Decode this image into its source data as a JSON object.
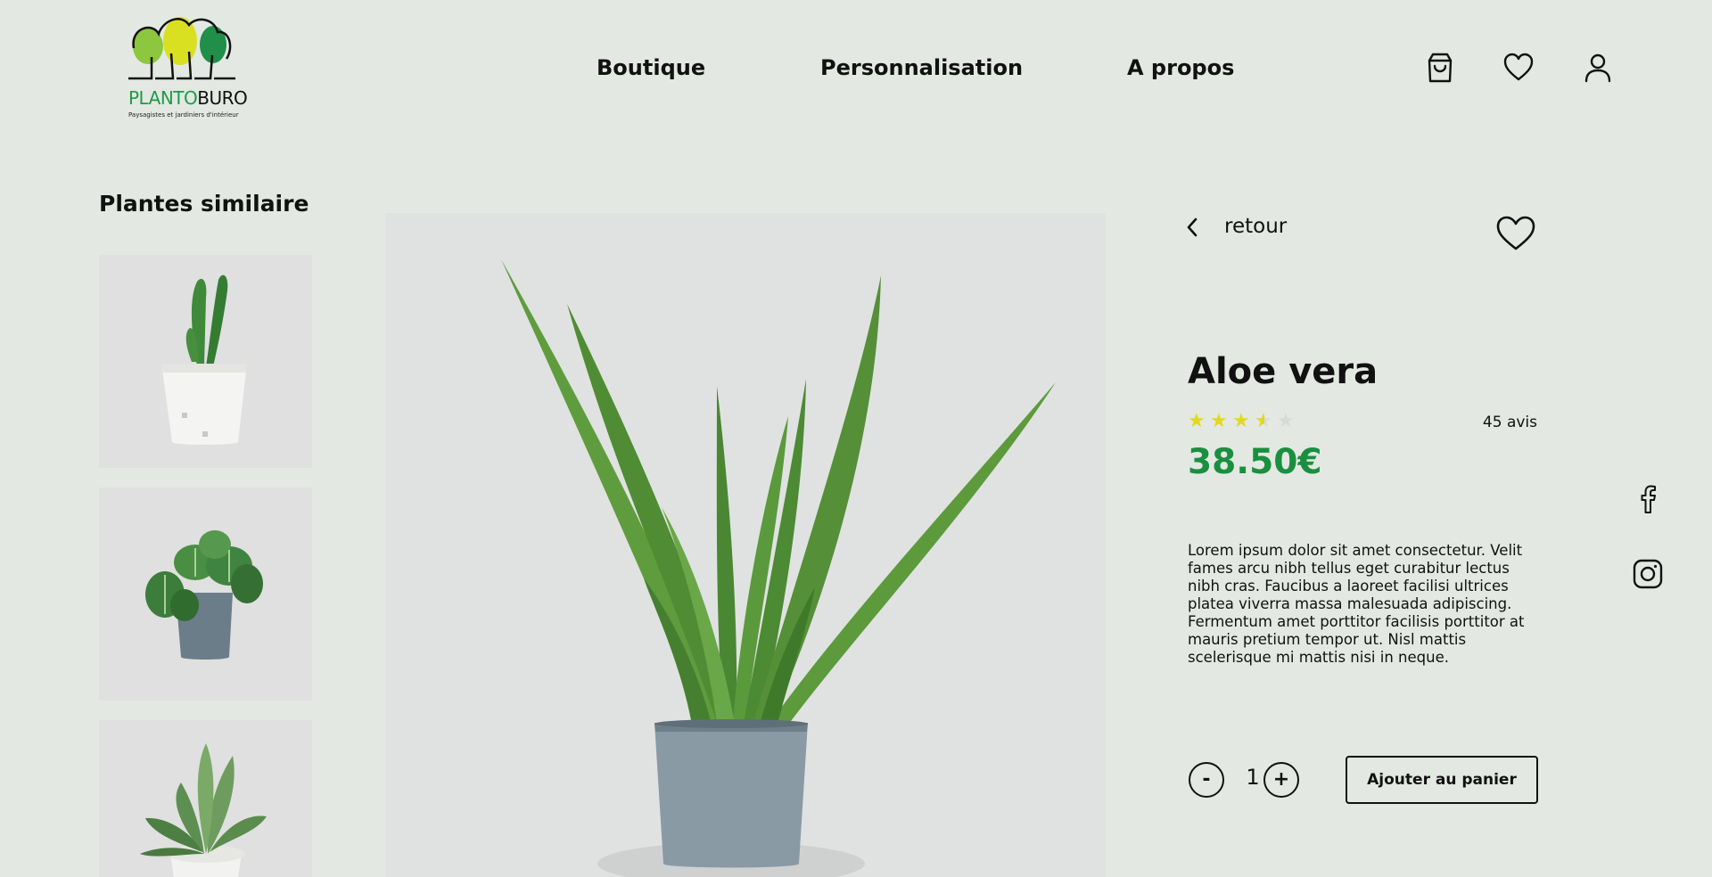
{
  "brand": {
    "name_part1": "PLANTO",
    "name_part2": "BURO",
    "tagline": "Paysagistes et jardiniers d'intérieur",
    "colors": {
      "green": "#1e9b45",
      "lime": "#8dc63f",
      "yellow": "#d9e021",
      "dark_green": "#1f8f4a"
    }
  },
  "nav": {
    "items": [
      {
        "label": "Boutique"
      },
      {
        "label": "Personnalisation"
      },
      {
        "label": "A propos"
      }
    ],
    "icons": [
      "shopping-bag-icon",
      "heart-icon",
      "user-icon"
    ]
  },
  "similar": {
    "title": "Plantes similaire",
    "items": [
      {
        "name": "cactus-white-pot"
      },
      {
        "name": "peperomia-grey-pot"
      },
      {
        "name": "succulent-white-pot"
      }
    ]
  },
  "product": {
    "back_label": "retour",
    "name": "Aloe vera",
    "rating": 3.5,
    "rating_max": 5,
    "reviews": "45 avis",
    "price": "38.50€",
    "description": "Lorem ipsum dolor sit amet consectetur. Velit fames arcu nibh tellus eget curabitur lectus nibh cras. Faucibus a laoreet facilisi ultrices platea viverra massa malesuada adipiscing. Fermentum amet porttitor facilisis porttitor at mauris pretium tempor ut. Nisl mattis scelerisque mi mattis nisi in neque.",
    "quantity": "1",
    "minus_label": "-",
    "plus_label": "+",
    "add_to_cart": "Ajouter au panier",
    "price_color": "#1a8f3f",
    "star_color": "#e3d91c"
  },
  "social": [
    "facebook-icon",
    "instagram-icon"
  ]
}
